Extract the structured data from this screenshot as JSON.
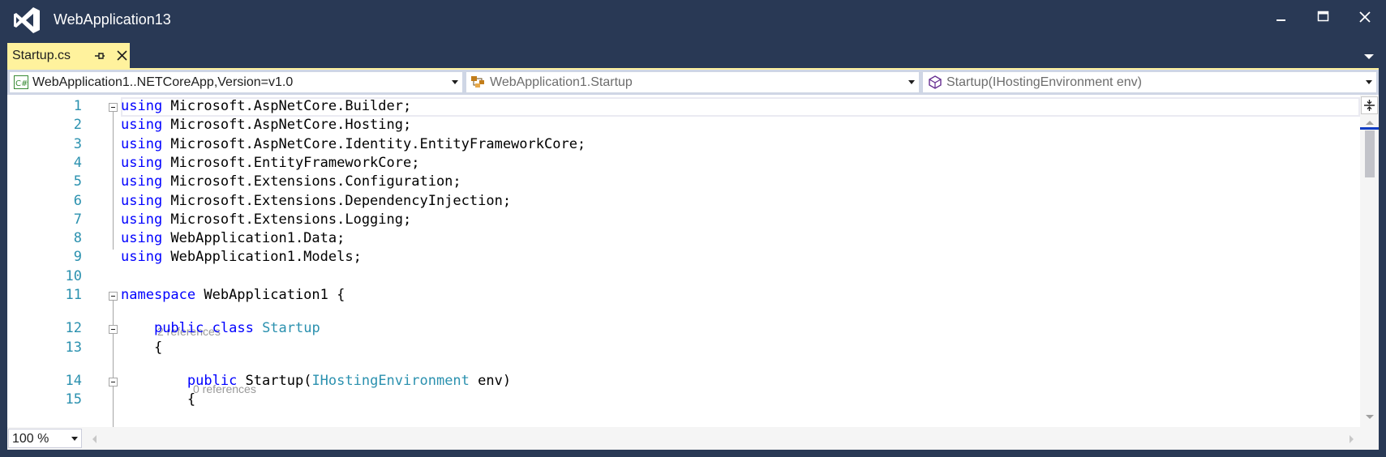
{
  "window": {
    "title": "WebApplication13"
  },
  "tabs": [
    {
      "label": "Startup.cs",
      "active": true
    }
  ],
  "navbar": {
    "project": "WebApplication1..NETCoreApp,Version=v1.0",
    "type": "WebApplication1.Startup",
    "member": "Startup(IHostingEnvironment env)"
  },
  "editor": {
    "lines": [
      {
        "num": "1",
        "parts": [
          [
            "kw",
            "using"
          ],
          [
            "t",
            " Microsoft.AspNetCore.Builder;"
          ]
        ]
      },
      {
        "num": "2",
        "parts": [
          [
            "kw",
            "using"
          ],
          [
            "t",
            " Microsoft.AspNetCore.Hosting;"
          ]
        ]
      },
      {
        "num": "3",
        "parts": [
          [
            "kw",
            "using"
          ],
          [
            "t",
            " Microsoft.AspNetCore.Identity.EntityFrameworkCore;"
          ]
        ]
      },
      {
        "num": "4",
        "parts": [
          [
            "kw",
            "using"
          ],
          [
            "t",
            " Microsoft.EntityFrameworkCore;"
          ]
        ]
      },
      {
        "num": "5",
        "parts": [
          [
            "kw",
            "using"
          ],
          [
            "t",
            " Microsoft.Extensions.Configuration;"
          ]
        ]
      },
      {
        "num": "6",
        "parts": [
          [
            "kw",
            "using"
          ],
          [
            "t",
            " Microsoft.Extensions.DependencyInjection;"
          ]
        ]
      },
      {
        "num": "7",
        "parts": [
          [
            "kw",
            "using"
          ],
          [
            "t",
            " Microsoft.Extensions.Logging;"
          ]
        ]
      },
      {
        "num": "8",
        "parts": [
          [
            "kw",
            "using"
          ],
          [
            "t",
            " WebApplication1.Data;"
          ]
        ]
      },
      {
        "num": "9",
        "parts": [
          [
            "kw",
            "using"
          ],
          [
            "t",
            " WebApplication1.Models;"
          ]
        ]
      },
      {
        "num": "10",
        "parts": []
      },
      {
        "num": "11",
        "parts": [
          [
            "kw",
            "namespace"
          ],
          [
            "t",
            " WebApplication1 {"
          ]
        ]
      },
      {
        "num": "12",
        "parts": [
          [
            "t",
            "    "
          ],
          [
            "kw",
            "public"
          ],
          [
            "t",
            " "
          ],
          [
            "kw",
            "class"
          ],
          [
            "t",
            " "
          ],
          [
            "type",
            "Startup"
          ]
        ]
      },
      {
        "num": "13",
        "parts": [
          [
            "t",
            "    {"
          ]
        ]
      },
      {
        "num": "14",
        "parts": [
          [
            "t",
            "        "
          ],
          [
            "kw",
            "public"
          ],
          [
            "t",
            " Startup("
          ],
          [
            "type",
            "IHostingEnvironment"
          ],
          [
            "t",
            " env)"
          ]
        ]
      },
      {
        "num": "15",
        "parts": [
          [
            "t",
            "        {"
          ]
        ]
      }
    ],
    "lens": [
      {
        "text": "2 references"
      },
      {
        "text": "0 references"
      }
    ]
  },
  "zoom": "100 %",
  "colors": {
    "chrome": "#293955",
    "active_tab": "#fff29d",
    "keyword": "#0000ff",
    "type": "#2b91af",
    "line_number": "#2b91af",
    "lens_text": "#999999"
  }
}
